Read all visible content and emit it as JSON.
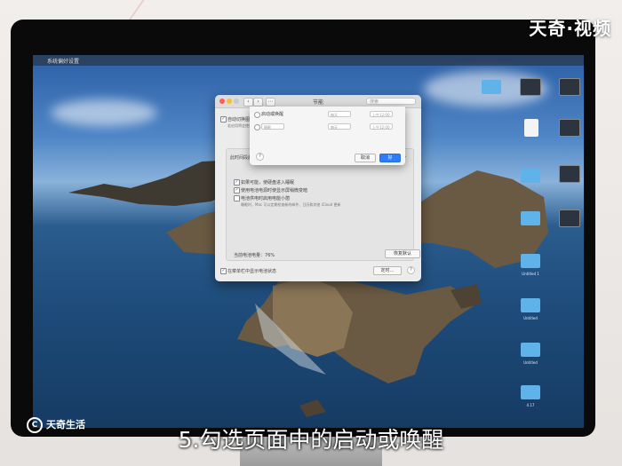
{
  "brand": "天奇·视频",
  "logo_text": "天奇生活",
  "caption": "5.勾选页面中的启动或唤醒",
  "menubar_text": "系统偏好设置",
  "prefs": {
    "title": "节能",
    "search_placeholder": "搜索",
    "auto_switch_label": "自动切换图形卡",
    "sub_note": "若启用将会使用更多电量",
    "graph_label": "此时间段后关闭显示器",
    "options": [
      "如果可能，使硬盘进入睡眠",
      "使用电池电源时使显示屏稍微变暗",
      "电池供电时启用电能小憩"
    ],
    "option_note": "睡眠时，Mac 可以定期检查新的邮件、日历和其他 iCloud 更新",
    "battery_label": "当前电池电量：",
    "battery_value": "76%",
    "restore_button": "恢复默认",
    "menu_status_label": "在菜单栏中显示电池状态",
    "schedule_button": "定时…",
    "help_label": "?"
  },
  "sheet": {
    "startup_label": "启动或唤醒",
    "row1_field1": "每天",
    "row1_field2": "上午12:00",
    "row2_field0": "睡眠",
    "row2_field1": "每天",
    "row2_field2": "上午12:00",
    "cancel_button": "取消",
    "ok_button": "好",
    "help_label": "?"
  },
  "desktop_icons": [
    {
      "label": "",
      "type": "folder"
    },
    {
      "label": "",
      "type": "thumb"
    },
    {
      "label": "",
      "type": "file"
    },
    {
      "label": "",
      "type": "folder"
    },
    {
      "label": "",
      "type": "folder"
    },
    {
      "label": "Untitled 1",
      "type": "folder"
    },
    {
      "label": "Untitled",
      "type": "folder"
    },
    {
      "label": "Untitled",
      "type": "folder"
    },
    {
      "label": "4.17",
      "type": "folder"
    }
  ]
}
